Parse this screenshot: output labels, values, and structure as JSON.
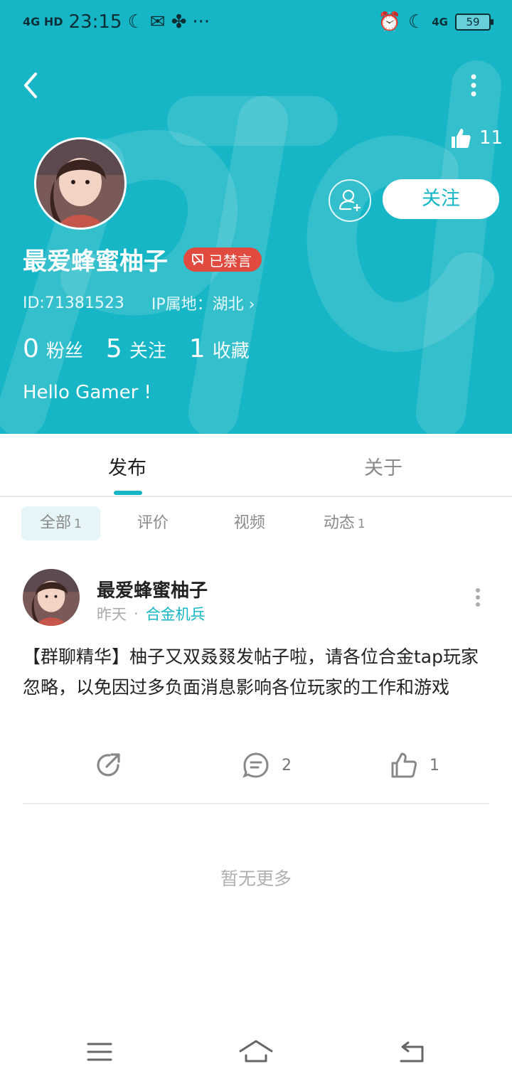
{
  "status_bar": {
    "network": "4G HD",
    "time": "23:15",
    "right_network": "4G",
    "battery": "59"
  },
  "header": {
    "like_count": "11",
    "follow_label": "关注"
  },
  "profile": {
    "name": "最爱蜂蜜柚子",
    "banned_label": "已禁言",
    "id_text": "ID:71381523",
    "ip_text": "IP属地：湖北",
    "stats": [
      {
        "num": "0",
        "label": "粉丝"
      },
      {
        "num": "5",
        "label": "关注"
      },
      {
        "num": "1",
        "label": "收藏"
      }
    ],
    "bio": "Hello Gamer !"
  },
  "tabs": [
    {
      "label": "发布"
    },
    {
      "label": "关于"
    }
  ],
  "filters": [
    {
      "label": "全部",
      "count": "1"
    },
    {
      "label": "评价",
      "count": ""
    },
    {
      "label": "视频",
      "count": ""
    },
    {
      "label": "动态",
      "count": "1"
    }
  ],
  "post": {
    "author": "最爱蜂蜜柚子",
    "time": "昨天",
    "separator": "·",
    "category": "合金机兵",
    "content": "【群聊精华】柚子又双叒叕发帖子啦，请各位合金tap玩家忽略，以免因过多负面消息影响各位玩家的工作和游戏",
    "comment_count": "2",
    "like_count": "1"
  },
  "footer": {
    "no_more": "暂无更多"
  },
  "colors": {
    "accent": "#16b6c6",
    "banned": "#e04a3f"
  }
}
